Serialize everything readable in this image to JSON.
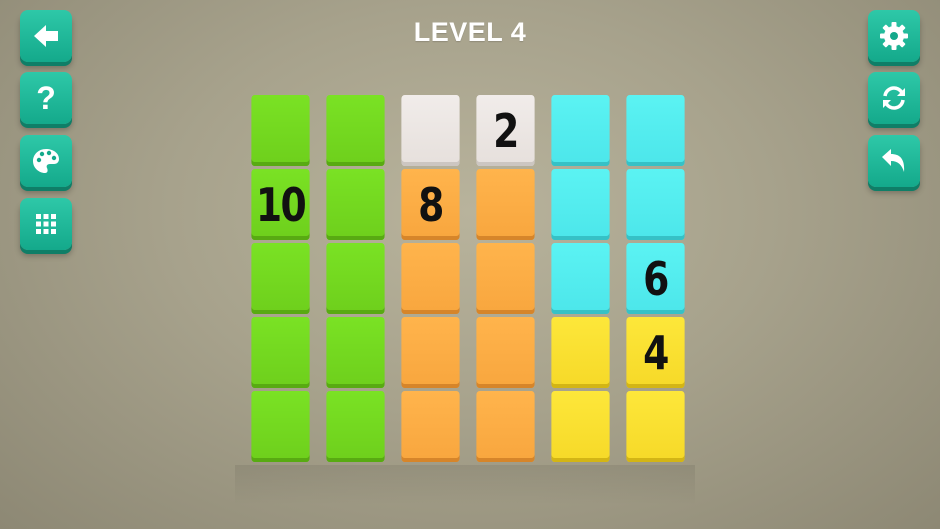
{
  "header": {
    "title": "LEVEL 4"
  },
  "left_buttons": [
    {
      "name": "back-button",
      "icon": "arrow-left-icon"
    },
    {
      "name": "help-button",
      "icon": "question-mark-icon",
      "glyph": "?"
    },
    {
      "name": "theme-button",
      "icon": "palette-icon"
    },
    {
      "name": "level-select-button",
      "icon": "grid-icon"
    }
  ],
  "right_buttons": [
    {
      "name": "settings-button",
      "icon": "gear-icon"
    },
    {
      "name": "restart-button",
      "icon": "refresh-icon"
    },
    {
      "name": "undo-button",
      "icon": "undo-icon"
    }
  ],
  "board": {
    "rows": 5,
    "cols": 6,
    "colors": {
      "green": "#74d820",
      "white": "#ece6e3",
      "orange": "#fcad45",
      "cyan": "#54ecef",
      "yellow": "#fae031"
    },
    "cells": [
      [
        {
          "color": "green",
          "label": ""
        },
        {
          "color": "green",
          "label": ""
        },
        {
          "color": "white",
          "label": ""
        },
        {
          "color": "white",
          "label": "2"
        },
        {
          "color": "cyan",
          "label": ""
        },
        {
          "color": "cyan",
          "label": ""
        }
      ],
      [
        {
          "color": "green",
          "label": "10"
        },
        {
          "color": "green",
          "label": ""
        },
        {
          "color": "orange",
          "label": "8"
        },
        {
          "color": "orange",
          "label": ""
        },
        {
          "color": "cyan",
          "label": ""
        },
        {
          "color": "cyan",
          "label": ""
        }
      ],
      [
        {
          "color": "green",
          "label": ""
        },
        {
          "color": "green",
          "label": ""
        },
        {
          "color": "orange",
          "label": ""
        },
        {
          "color": "orange",
          "label": ""
        },
        {
          "color": "cyan",
          "label": ""
        },
        {
          "color": "cyan",
          "label": "6"
        }
      ],
      [
        {
          "color": "green",
          "label": ""
        },
        {
          "color": "green",
          "label": ""
        },
        {
          "color": "orange",
          "label": ""
        },
        {
          "color": "orange",
          "label": ""
        },
        {
          "color": "yellow",
          "label": ""
        },
        {
          "color": "yellow",
          "label": "4"
        }
      ],
      [
        {
          "color": "green",
          "label": ""
        },
        {
          "color": "green",
          "label": ""
        },
        {
          "color": "orange",
          "label": ""
        },
        {
          "color": "orange",
          "label": ""
        },
        {
          "color": "yellow",
          "label": ""
        },
        {
          "color": "yellow",
          "label": ""
        }
      ]
    ]
  }
}
